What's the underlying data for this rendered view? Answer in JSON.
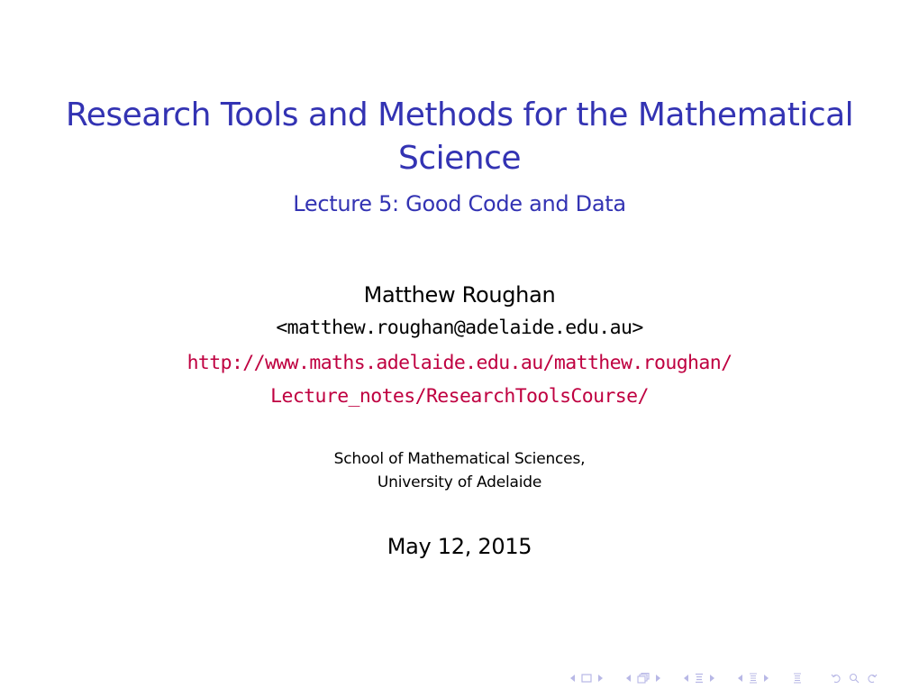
{
  "slide": {
    "title_line1": "Research Tools and Methods for the Mathematical",
    "title_line2": "Science",
    "subtitle": "Lecture 5: Good Code and Data",
    "author": "Matthew Roughan",
    "email": "<matthew.roughan@adelaide.edu.au>",
    "url_line1": "http://www.maths.adelaide.edu.au/matthew.roughan/",
    "url_line2": "Lecture_notes/ResearchToolsCourse/",
    "institution_line1": "School of Mathematical Sciences,",
    "institution_line2": "University of Adelaide",
    "date": "May 12, 2015"
  },
  "colors": {
    "title": "#3333b3",
    "url": "#bf0040",
    "text": "#000000",
    "nav": "#9c9cd9"
  },
  "navigation": {
    "icons": [
      "frame-nav-icon",
      "subsection-nav-icon",
      "section-nav-icon",
      "subsection-list-icon",
      "outline-icon",
      "undo-icon",
      "search-icon",
      "redo-icon"
    ]
  }
}
